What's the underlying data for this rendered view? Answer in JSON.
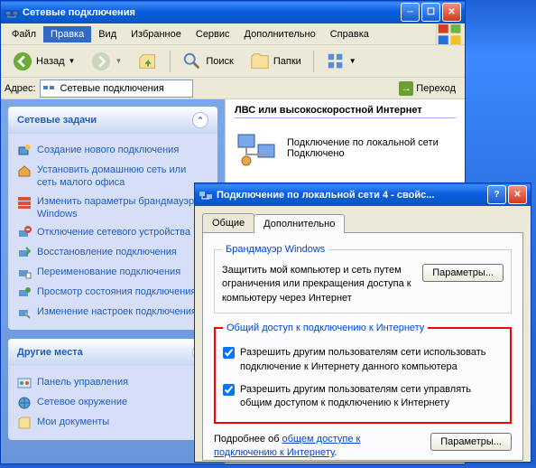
{
  "main": {
    "title": "Сетевые подключения",
    "menu": {
      "file": "Файл",
      "edit": "Правка",
      "view": "Вид",
      "favorites": "Избранное",
      "tools": "Сервис",
      "advanced": "Дополнительно",
      "help": "Справка"
    },
    "toolbar": {
      "back": "Назад",
      "search": "Поиск",
      "folders": "Папки"
    },
    "address": {
      "label": "Адрес:",
      "value": "Сетевые подключения",
      "go": "Переход"
    },
    "group_header": "ЛВС или высокоскоростной Интернет",
    "connection": {
      "name": "Подключение по локальной сети",
      "status": "Подключено"
    }
  },
  "sidebar": {
    "tasks": {
      "title": "Сетевые задачи",
      "items": [
        "Создание нового подключения",
        "Установить домашнюю сеть или сеть малого офиса",
        "Изменить параметры брандмауэра Windows",
        "Отключение сетевого устройства",
        "Восстановление подключения",
        "Переименование подключения",
        "Просмотр состояния подключения",
        "Изменение настроек подключения"
      ]
    },
    "other": {
      "title": "Другие места",
      "items": [
        "Панель управления",
        "Сетевое окружение",
        "Мои документы"
      ]
    }
  },
  "dialog": {
    "title": "Подключение по локальной сети 4 - свойс...",
    "tabs": {
      "general": "Общие",
      "advanced": "Дополнительно"
    },
    "firewall": {
      "legend": "Брандмауэр Windows",
      "text": "Защитить мой компьютер и сеть путем ограничения или прекращения доступа к компьютеру через Интернет",
      "btn": "Параметры..."
    },
    "ics": {
      "legend": "Общий доступ к подключению к Интернету",
      "chk1": "Разрешить другим пользователям сети использовать подключение к Интернету данного компьютера",
      "chk2": "Разрешить другим пользователям сети управлять общим доступом к подключению к Интернету"
    },
    "footer": {
      "text1": "Подробнее об ",
      "link": "общем доступе к подключению к Интернету",
      "text2": ".",
      "btn": "Параметры..."
    }
  }
}
